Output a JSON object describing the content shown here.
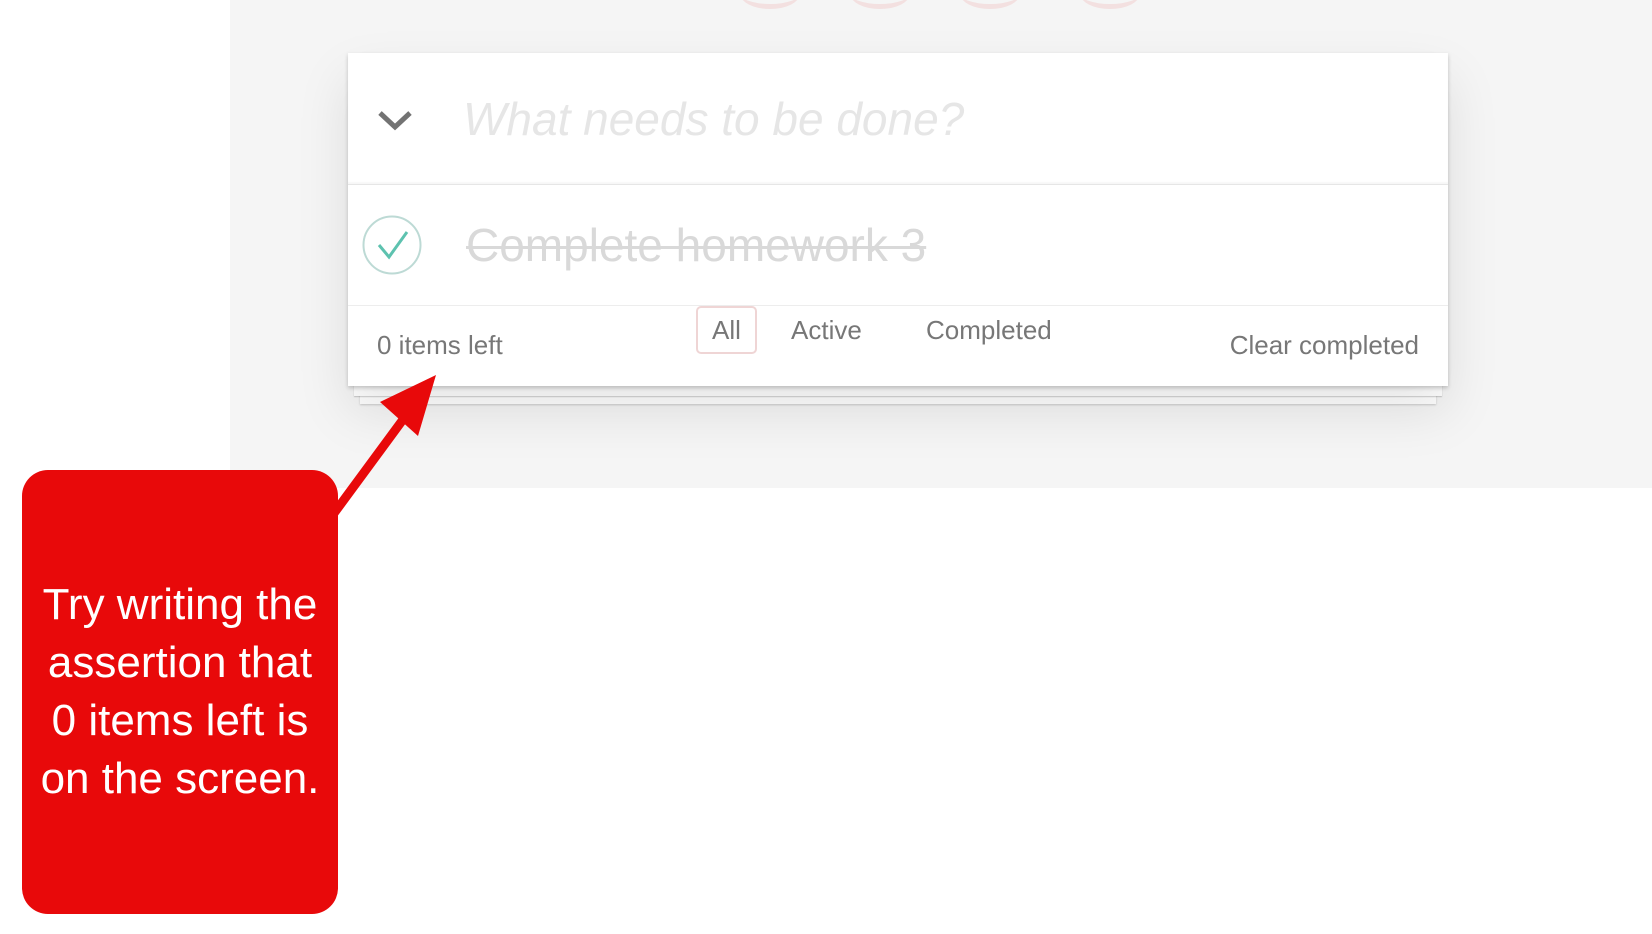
{
  "todo": {
    "new_todo_placeholder": "What needs to be done?",
    "items": [
      {
        "label": "Complete homework 3",
        "completed": true
      }
    ],
    "footer": {
      "items_left": "0 items left",
      "filters": [
        {
          "label": "All",
          "selected": true
        },
        {
          "label": "Active",
          "selected": false
        },
        {
          "label": "Completed",
          "selected": false
        }
      ],
      "clear_completed": "Clear completed"
    }
  },
  "annotation": {
    "text": "Try writing the assertion that 0 items left is on the screen."
  },
  "colors": {
    "app_background": "#f5f5f5",
    "callout_red": "#e8090a",
    "check_green": "#5dc2af",
    "selected_filter_border": "#efd5d5"
  },
  "icons": {
    "toggle_all": "chevron-down-icon",
    "completed_check": "checkmark-circle-icon",
    "arrow": "arrow-icon"
  }
}
